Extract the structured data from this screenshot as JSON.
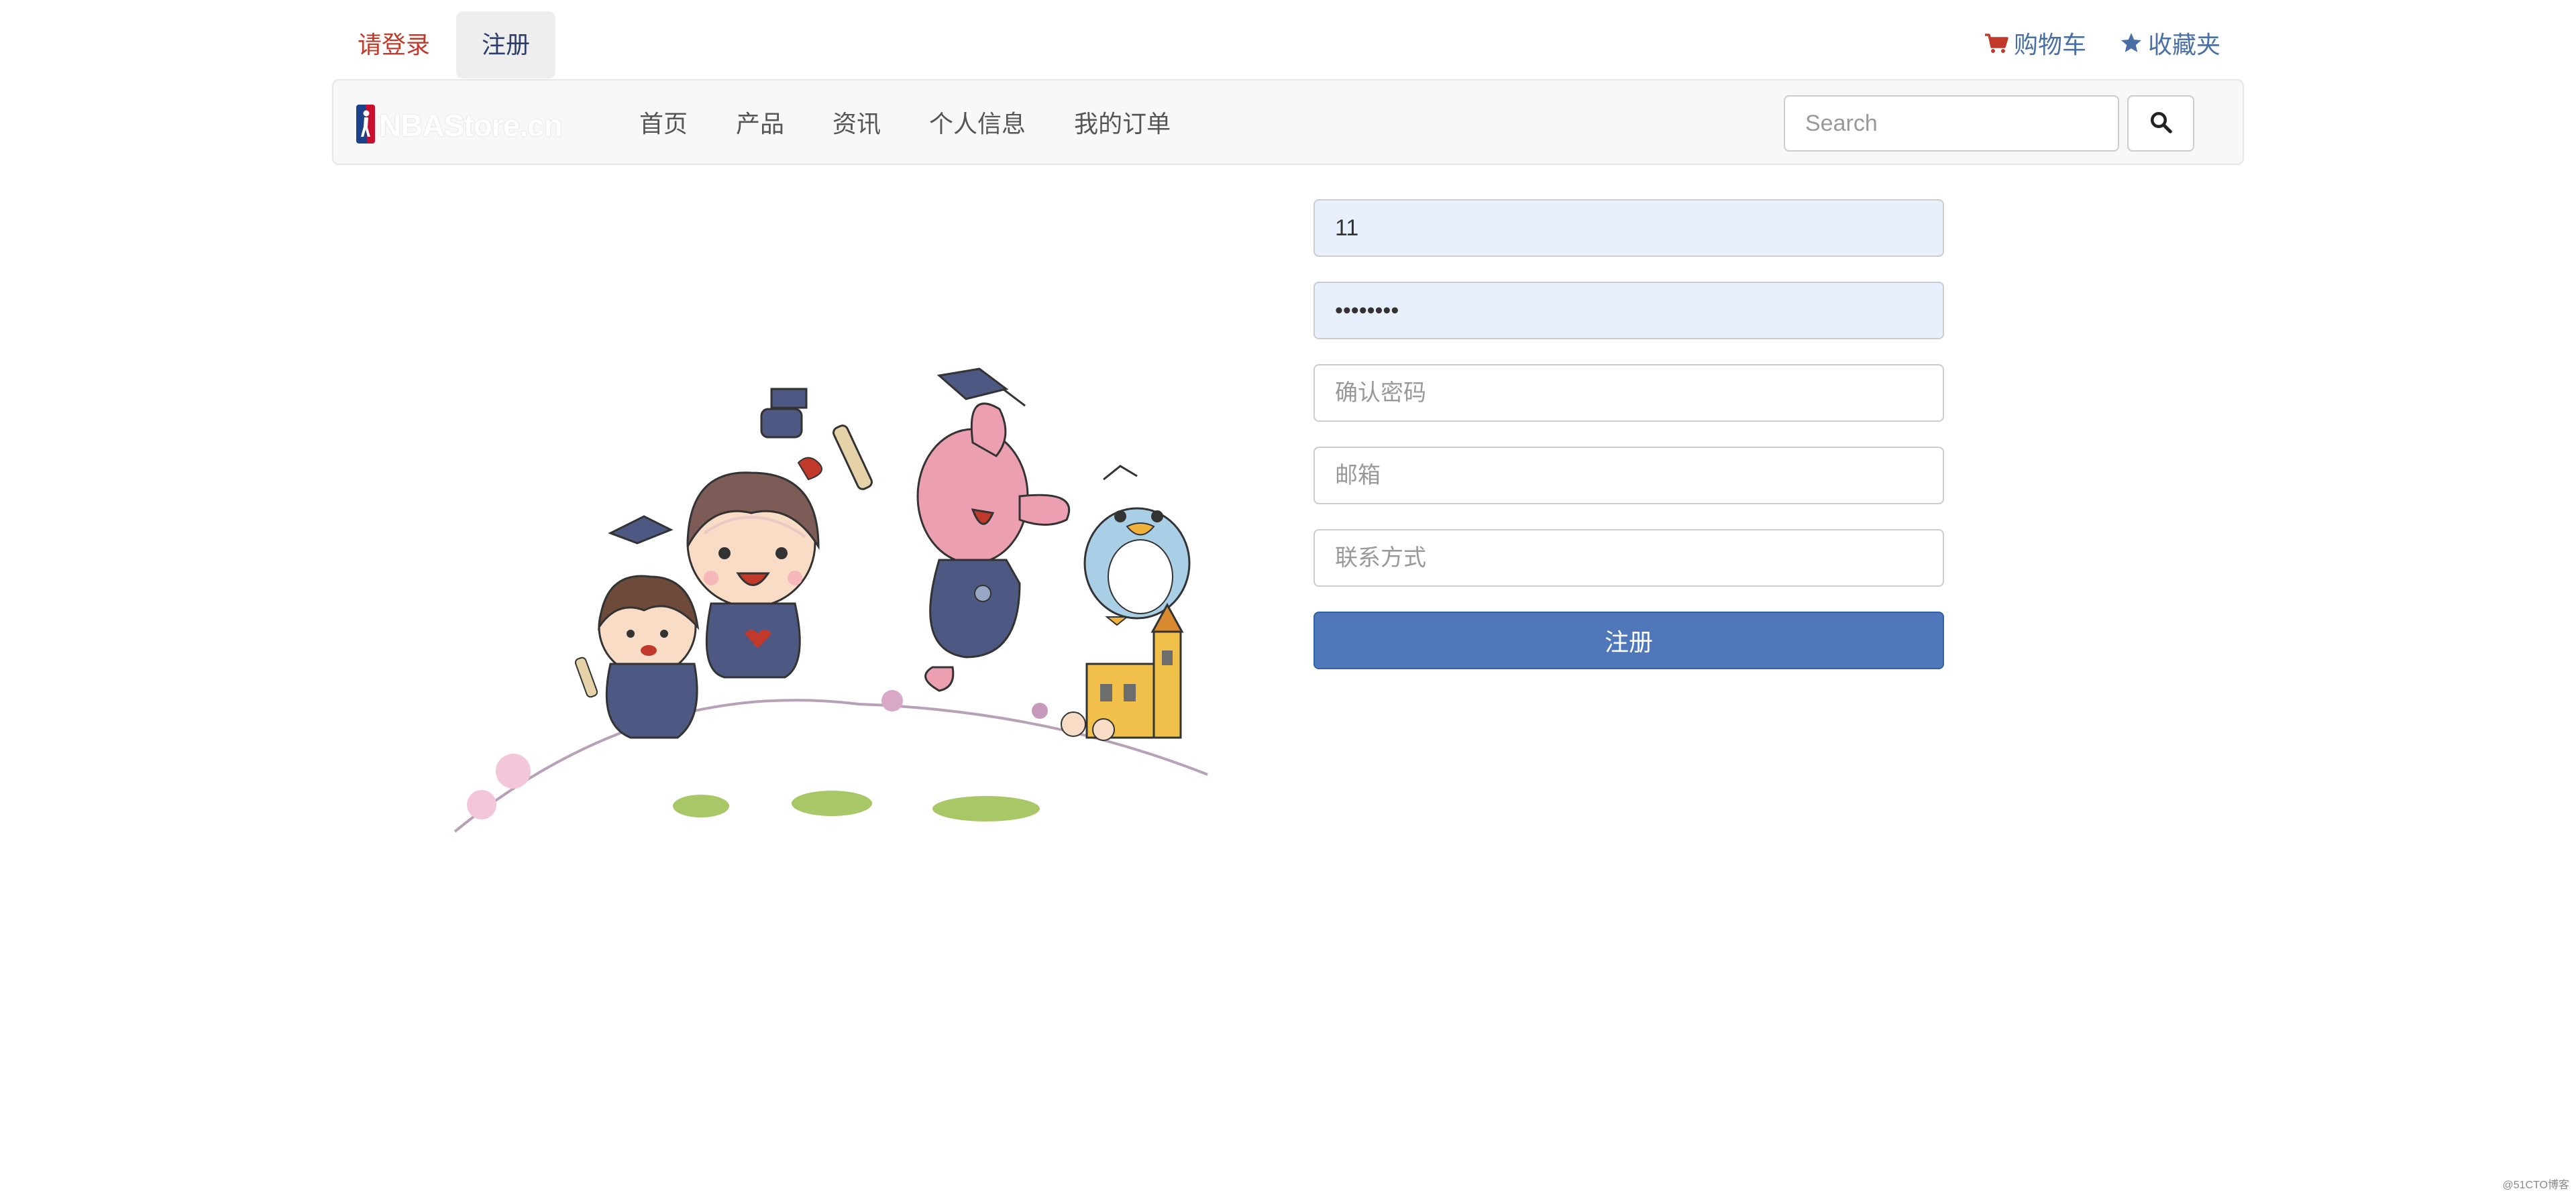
{
  "topbar": {
    "login_label": "请登录",
    "register_label": "注册",
    "cart_label": "购物车",
    "cart_icon": "cart-icon",
    "favorites_label": "收藏夹",
    "favorites_icon": "star-icon"
  },
  "navbar": {
    "brand_text": "NBAStore.cn",
    "links": [
      {
        "label": "首页"
      },
      {
        "label": "产品"
      },
      {
        "label": "资讯"
      },
      {
        "label": "个人信息"
      },
      {
        "label": "我的订单"
      }
    ],
    "search": {
      "placeholder": "Search",
      "button_icon": "search-icon"
    }
  },
  "form": {
    "username_value": "11",
    "password_value": "11111111",
    "confirm_placeholder": "确认密码",
    "email_placeholder": "邮箱",
    "contact_placeholder": "联系方式",
    "submit_label": "注册"
  },
  "watermark": "@51CTO博客",
  "colors": {
    "login_red": "#c0392b",
    "link_blue": "#4a6fa5",
    "button_blue": "#4f77b9",
    "autofill_bg": "#e8f0fe"
  }
}
